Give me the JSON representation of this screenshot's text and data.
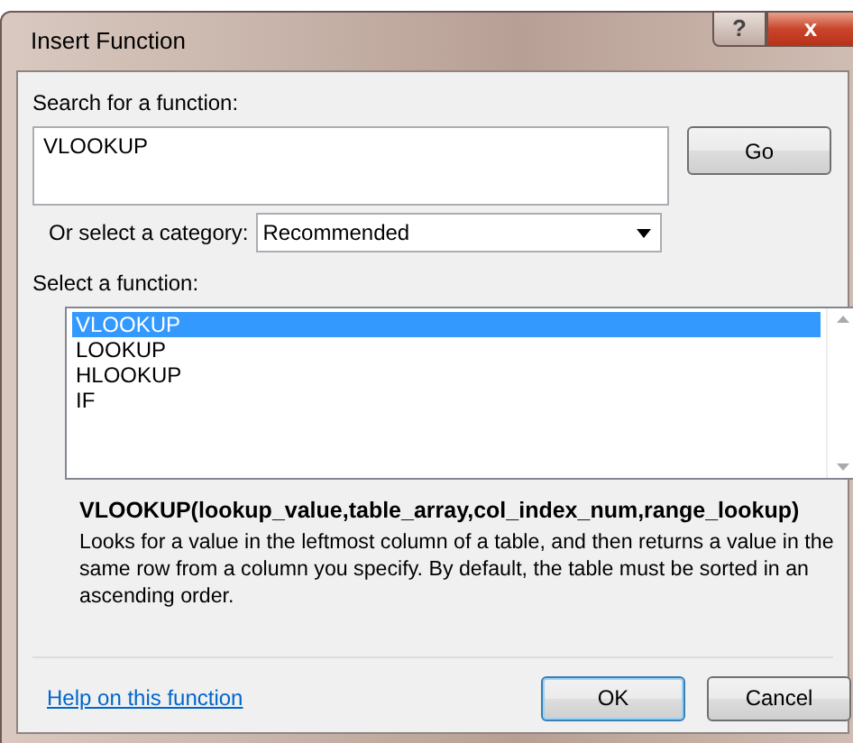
{
  "window": {
    "title": "Insert Function",
    "help_button": "?",
    "close_button": "x"
  },
  "search": {
    "label": "Search for a function:",
    "value": "VLOOKUP",
    "button": {
      "label": "Go"
    }
  },
  "category": {
    "label": "Or select a category:",
    "value": "Recommended"
  },
  "functions": {
    "label": "Select a function:",
    "items": [
      {
        "label": "VLOOKUP",
        "selected": true
      },
      {
        "label": "LOOKUP",
        "selected": false
      },
      {
        "label": "HLOOKUP",
        "selected": false
      },
      {
        "label": "IF",
        "selected": false
      }
    ]
  },
  "signature": "VLOOKUP(lookup_value,table_array,col_index_num,range_lookup)",
  "description": "Looks for a value in the leftmost column of a table, and then returns a value in the same row from a column you specify. By default, the table must be sorted in an ascending order.",
  "help_link": "Help on this function",
  "buttons": [
    {
      "label": "OK",
      "kind": "default"
    },
    {
      "label": "Cancel",
      "kind": "normal"
    }
  ]
}
